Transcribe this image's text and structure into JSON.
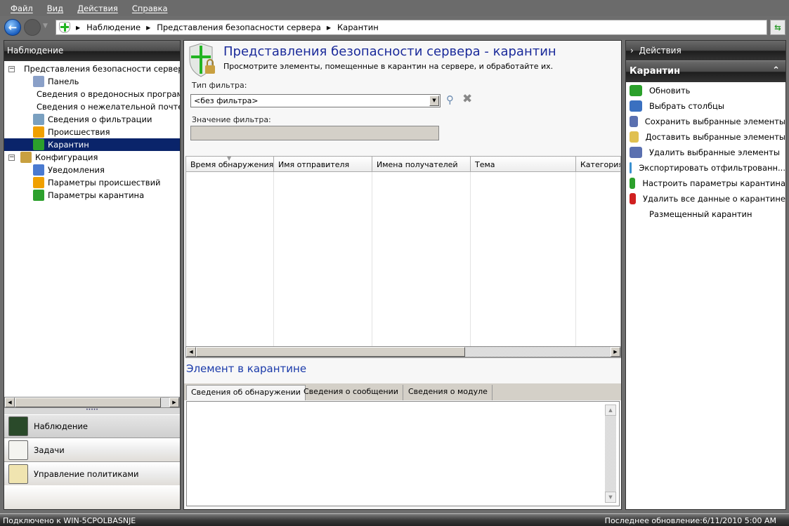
{
  "menu": [
    "Файл",
    "Вид",
    "Действия",
    "Справка"
  ],
  "breadcrumb": [
    "Наблюдение",
    "Представления безопасности сервера",
    "Карантин"
  ],
  "left": {
    "header": "Наблюдение",
    "tree": [
      {
        "label": "Представления безопасности сервера",
        "level": 0,
        "expanded": true,
        "icon": "security-views-icon",
        "color": "#2ca02c"
      },
      {
        "label": "Панель",
        "level": 1,
        "icon": "dashboard-icon",
        "color": "#8aa0c8"
      },
      {
        "label": "Сведения о вредоносных програм",
        "level": 1,
        "icon": "malware-icon",
        "color": "#4a7ad0"
      },
      {
        "label": "Сведения о нежелательной почте",
        "level": 1,
        "icon": "spam-icon",
        "color": "#e0b020"
      },
      {
        "label": "Сведения о фильтрации",
        "level": 1,
        "icon": "filter-icon",
        "color": "#7aa0c0"
      },
      {
        "label": "Происшествия",
        "level": 1,
        "icon": "incidents-icon",
        "color": "#f0a000"
      },
      {
        "label": "Карантин",
        "level": 1,
        "icon": "quarantine-icon",
        "color": "#2ca02c",
        "selected": true
      },
      {
        "label": "Конфигурация",
        "level": 0,
        "expanded": true,
        "icon": "tools-icon",
        "color": "#c8a040"
      },
      {
        "label": "Уведомления",
        "level": 1,
        "icon": "notifications-icon",
        "color": "#4a7ad0"
      },
      {
        "label": "Параметры происшествий",
        "level": 1,
        "icon": "incident-settings-icon",
        "color": "#f0a000"
      },
      {
        "label": "Параметры карантина",
        "level": 1,
        "icon": "quarantine-settings-icon",
        "color": "#2ca02c"
      }
    ],
    "nav": [
      {
        "label": "Наблюдение",
        "icon": "monitor-icon",
        "active": true
      },
      {
        "label": "Задачи",
        "icon": "clipboard-check-icon"
      },
      {
        "label": "Управление политиками",
        "icon": "policy-documents-icon"
      }
    ]
  },
  "center": {
    "title": "Представления безопасности сервера - карантин",
    "subtitle": "Просмотрите элементы, помещенные в карантин на сервере, и обработайте их.",
    "filter_type_label": "Тип фильтра:",
    "filter_type_value": "<без фильтра>",
    "filter_value_label": "Значение фильтра:",
    "columns": [
      "Время обнаружения",
      "Имя отправителя",
      "Имена получателей",
      "Тема",
      "Категория"
    ],
    "section_title": "Элемент в карантине",
    "tabs": [
      "Сведения об обнаружении",
      "Сведения о сообщении",
      "Сведения о модуле"
    ]
  },
  "right": {
    "header": "Действия",
    "section": "Карантин",
    "actions": [
      {
        "label": "Обновить",
        "icon": "refresh-icon",
        "color": "#2aa02a"
      },
      {
        "label": "Выбрать столбцы",
        "icon": "columns-icon",
        "color": "#3a70c0"
      },
      {
        "label": "Сохранить выбранные элементы",
        "icon": "save-items-icon",
        "color": "#5a70b0"
      },
      {
        "label": "Доставить выбранные элементы",
        "icon": "deliver-items-icon",
        "color": "#e0c050"
      },
      {
        "label": "Удалить выбранные элементы",
        "icon": "delete-items-icon",
        "color": "#5a70b0"
      },
      {
        "label": "Экспортировать отфильтрованн...",
        "icon": "export-icon",
        "color": "#3a90d0"
      },
      {
        "label": "Настроить параметры карантина",
        "icon": "quarantine-settings-icon",
        "color": "#2ca02c"
      },
      {
        "label": "Удалить все данные о карантине",
        "icon": "delete-all-icon",
        "color": "#d02020"
      },
      {
        "label": "Размещенный карантин",
        "icon": "",
        "color": ""
      }
    ]
  },
  "status": {
    "left": "Подключено к WIN-5CPOLBASNJE",
    "right": "Последнее обновление:6/11/2010 5:00 AM"
  }
}
